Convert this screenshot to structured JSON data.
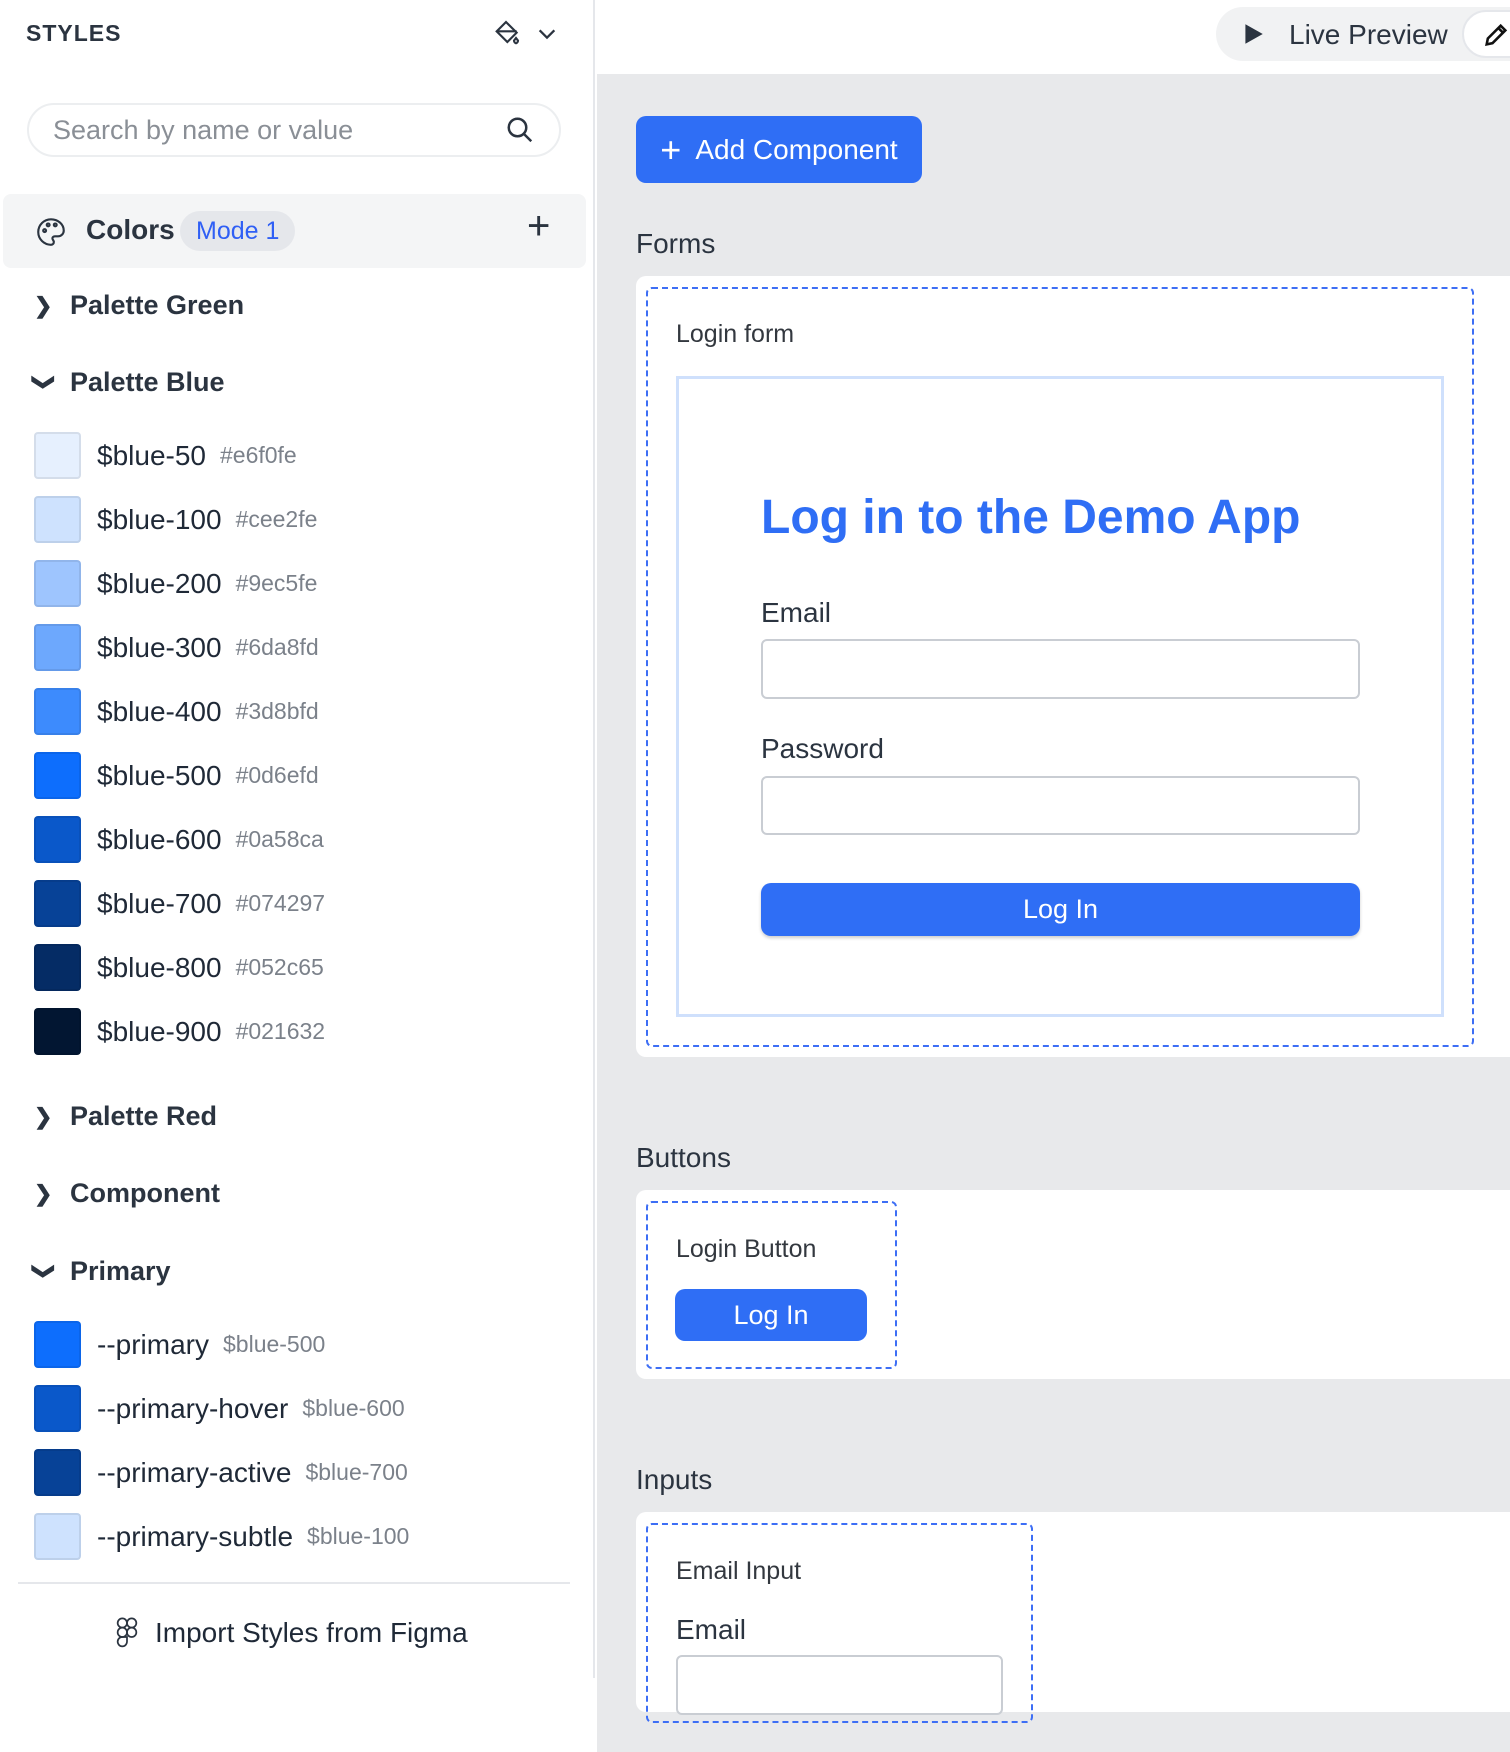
{
  "sidebar": {
    "title": "STYLES",
    "search_placeholder": "Search by name or value",
    "colors": {
      "label": "Colors",
      "mode": "Mode 1"
    },
    "groups": {
      "green": "Palette Green",
      "blue": "Palette Blue",
      "red": "Palette Red",
      "component": "Component",
      "primary": "Primary"
    },
    "blue": [
      {
        "name": "$blue-50",
        "value": "#e6f0fe",
        "color": "#e6f0fe"
      },
      {
        "name": "$blue-100",
        "value": "#cee2fe",
        "color": "#cee2fe"
      },
      {
        "name": "$blue-200",
        "value": "#9ec5fe",
        "color": "#9ec5fe"
      },
      {
        "name": "$blue-300",
        "value": "#6da8fd",
        "color": "#6da8fd"
      },
      {
        "name": "$blue-400",
        "value": "#3d8bfd",
        "color": "#3d8bfd"
      },
      {
        "name": "$blue-500",
        "value": "#0d6efd",
        "color": "#0d6efd"
      },
      {
        "name": "$blue-600",
        "value": "#0a58ca",
        "color": "#0a58ca"
      },
      {
        "name": "$blue-700",
        "value": "#074297",
        "color": "#074297"
      },
      {
        "name": "$blue-800",
        "value": "#052c65",
        "color": "#052c65"
      },
      {
        "name": "$blue-900",
        "value": "#021632",
        "color": "#021632"
      }
    ],
    "primary": [
      {
        "name": "--primary",
        "value": "$blue-500",
        "color": "#0d6efd"
      },
      {
        "name": "--primary-hover",
        "value": "$blue-600",
        "color": "#0a58ca"
      },
      {
        "name": "--primary-active",
        "value": "$blue-700",
        "color": "#074297"
      },
      {
        "name": "--primary-subtle",
        "value": "$blue-100",
        "color": "#cee2fe"
      }
    ],
    "import_label": "Import Styles from Figma"
  },
  "topbar": {
    "live_preview": "Live Preview"
  },
  "main": {
    "add_component": "Add Component",
    "forms": {
      "section": "Forms",
      "component": "Login form",
      "heading": "Log in to the Demo App",
      "email": "Email",
      "password": "Password",
      "button": "Log In"
    },
    "buttons": {
      "section": "Buttons",
      "component": "Login Button",
      "button": "Log In"
    },
    "inputs": {
      "section": "Inputs",
      "component": "Email Input",
      "email": "Email"
    }
  }
}
